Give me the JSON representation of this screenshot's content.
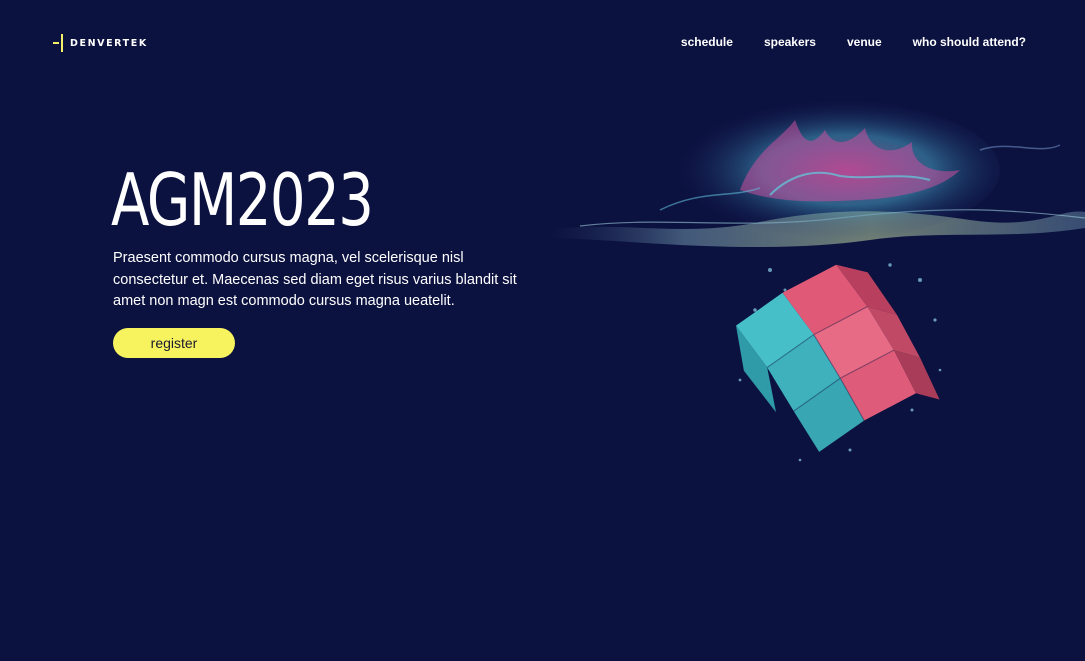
{
  "header": {
    "logo_text": "DENVERTEK",
    "logo_icon": "plus-bracket-logo-icon",
    "nav": [
      {
        "label": "schedule"
      },
      {
        "label": "speakers"
      },
      {
        "label": "venue"
      },
      {
        "label": "who should attend?"
      }
    ]
  },
  "hero": {
    "title": "AGM2023",
    "body": "Praesent commodo cursus magna, vel scelerisque nisl consectetur et. Maecenas sed diam eget risus varius blandit sit amet non magn est commodo cursus magna ueatelit.",
    "cta_label": "register"
  },
  "colors": {
    "background": "#0c1240",
    "accent": "#f7f35e",
    "text": "#ffffff"
  }
}
